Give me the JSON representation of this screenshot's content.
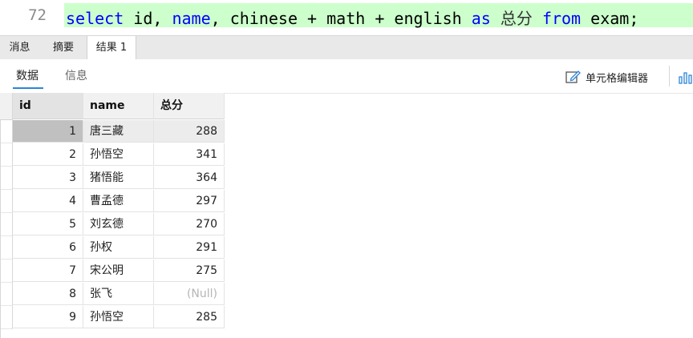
{
  "editor": {
    "line_number": "72",
    "tokens": [
      {
        "text": "select",
        "kw": true
      },
      {
        "text": " id, ",
        "kw": false
      },
      {
        "text": "name",
        "kw": true
      },
      {
        "text": ", chinese + math + english ",
        "kw": false
      },
      {
        "text": "as",
        "kw": true
      },
      {
        "text": " ",
        "kw": false
      },
      {
        "text": "总分",
        "kw": false,
        "cn": true
      },
      {
        "text": " ",
        "kw": false
      },
      {
        "text": "from",
        "kw": true
      },
      {
        "text": " exam;",
        "kw": false
      }
    ],
    "highlight_color": "#ccffcc",
    "keyword_color": "#0000ff"
  },
  "result_tabs": [
    {
      "label": "消息",
      "active": false
    },
    {
      "label": "摘要",
      "active": false
    },
    {
      "label": "结果 1",
      "active": true
    }
  ],
  "subtabs": [
    {
      "label": "数据",
      "active": true
    },
    {
      "label": "信息",
      "active": false
    }
  ],
  "toolbar": {
    "cell_editor_label": "单元格编辑器",
    "cell_editor_icon": "edit-icon",
    "chart_icon": "chart-icon"
  },
  "grid": {
    "columns": [
      "id",
      "name",
      "总分"
    ],
    "rows": [
      {
        "id": "1",
        "name": "唐三藏",
        "total": "288",
        "selected": true
      },
      {
        "id": "2",
        "name": "孙悟空",
        "total": "341"
      },
      {
        "id": "3",
        "name": "猪悟能",
        "total": "364"
      },
      {
        "id": "4",
        "name": "曹孟德",
        "total": "297"
      },
      {
        "id": "5",
        "name": "刘玄德",
        "total": "270"
      },
      {
        "id": "6",
        "name": "孙权",
        "total": "291"
      },
      {
        "id": "7",
        "name": "宋公明",
        "total": "275"
      },
      {
        "id": "8",
        "name": "张飞",
        "total": "(Null)",
        "null": true
      },
      {
        "id": "9",
        "name": "孙悟空",
        "total": "285"
      }
    ]
  },
  "colors": {
    "accent": "#2c86d8",
    "selected_id_cell": "#c0c0c0",
    "null_text": "#b5b5b5"
  }
}
